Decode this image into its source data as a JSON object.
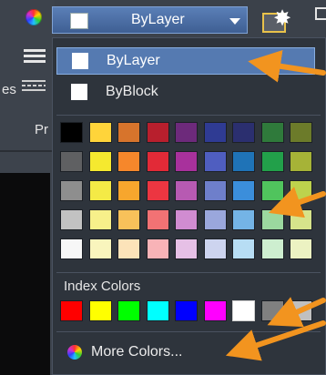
{
  "left_strip": {
    "cut_es": "es",
    "cut_pr": "Pr"
  },
  "dropdown": {
    "selected_label": "ByLayer",
    "selected_color": "#ffffff"
  },
  "popup": {
    "options": [
      {
        "label": "ByLayer",
        "color": "#ffffff",
        "highlighted": true
      },
      {
        "label": "ByBlock",
        "color": "#ffffff",
        "highlighted": false
      }
    ],
    "standard_colors": [
      [
        "#000000",
        "#ffd43a",
        "#d7742c",
        "#b81f2d",
        "#6d2a7b",
        "#2f3b93",
        "#2b2f6f",
        "#2f7a3b",
        "#6c7b2a"
      ],
      [
        "#5f6062",
        "#f5e92f",
        "#f6872b",
        "#e22a37",
        "#a8319c",
        "#4f5ec0",
        "#1f73b7",
        "#22a04a",
        "#a6b337"
      ],
      [
        "#8e8e8e",
        "#f4ea46",
        "#f7a62d",
        "#ec3641",
        "#b75ab2",
        "#6e7fcb",
        "#3b8edb",
        "#50c45d",
        "#bdd24d"
      ],
      [
        "#c2c2c2",
        "#f7f08a",
        "#f8c15a",
        "#f27274",
        "#d08cd1",
        "#9aa7dc",
        "#74b4e6",
        "#9bd89f",
        "#d6e38b"
      ],
      [
        "#f7f7f7",
        "#f9f5bd",
        "#fce3b9",
        "#f8b3b7",
        "#e6c0e6",
        "#cdd4ef",
        "#b7ddf4",
        "#cdeecf",
        "#ecf2c2"
      ]
    ],
    "index_colors_title": "Index Colors",
    "index_colors": [
      "#ff0000",
      "#ffff00",
      "#00ff00",
      "#00ffff",
      "#0000ff",
      "#ff00ff",
      "#ffffff",
      "#808080",
      "#c0c0c0"
    ],
    "more_colors_label": "More Colors..."
  },
  "annotation_color": "#f2941f"
}
